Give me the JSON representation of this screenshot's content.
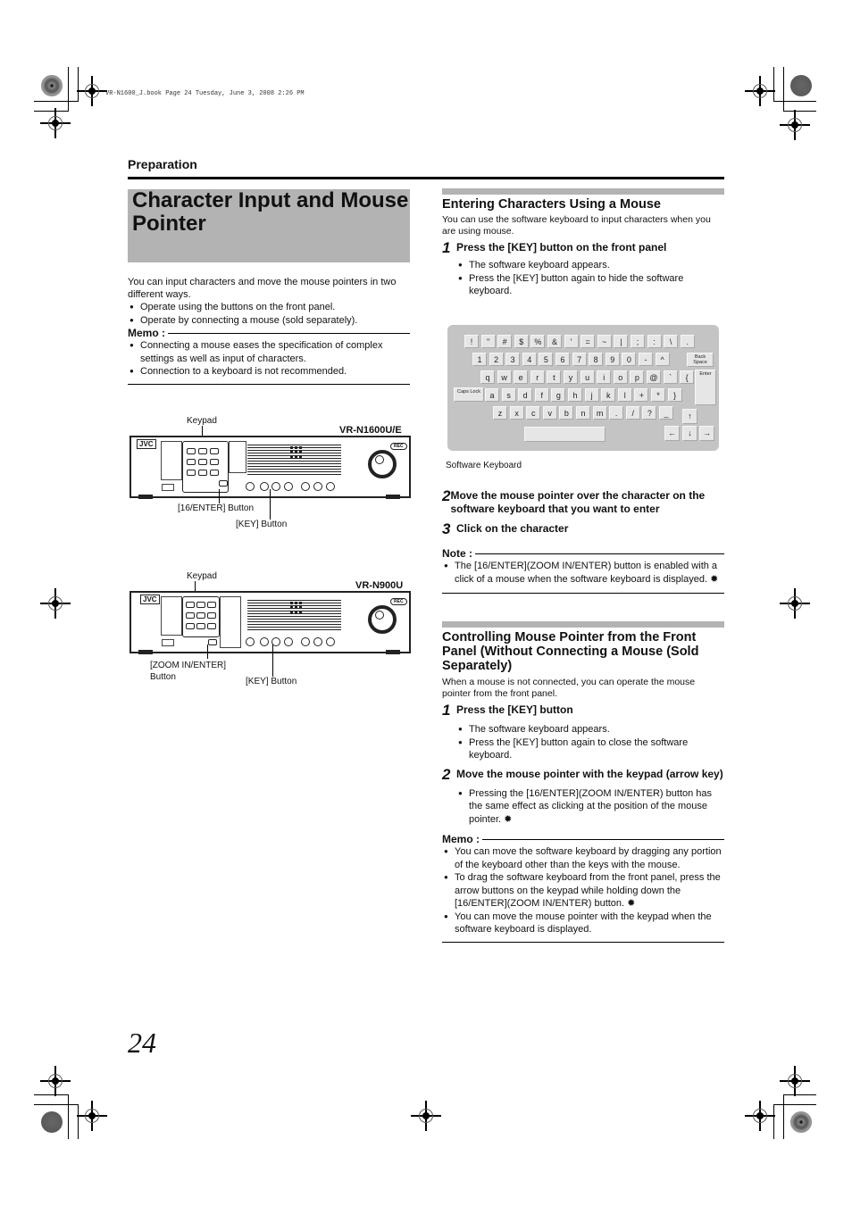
{
  "print_header": "VR-N1600_J.book  Page 24  Tuesday, June 3, 2008  2:26 PM",
  "section": "Preparation",
  "page_title": "Character Input and Mouse Pointer",
  "intro": {
    "text": "You can input characters and move the mouse pointers in two different ways.",
    "bullets": [
      "Operate using the buttons on the front panel.",
      "Operate by connecting a mouse (sold separately)."
    ]
  },
  "memo1": {
    "label": "Memo :",
    "bullets": [
      "Connecting a mouse eases the specification of complex settings as well as input of characters.",
      "Connection to a keyboard is not recommended."
    ]
  },
  "figures": {
    "device1": {
      "model": "VR-N1600U/E",
      "brand": "JVC",
      "keypad_label": "Keypad",
      "enter_label": "[16/ENTER] Button",
      "key_label": "[KEY] Button",
      "rec_label": "REC"
    },
    "device2": {
      "model": "VR-N900U",
      "brand": "JVC",
      "keypad_label": "Keypad",
      "enter_label_line1": "[ZOOM IN/ENTER]",
      "enter_label_line2": "Button",
      "key_label": "[KEY] Button",
      "rec_label": "REC"
    }
  },
  "entering": {
    "heading": "Entering Characters Using a Mouse",
    "intro": "You can use the software keyboard to input characters when you are using mouse.",
    "step1": {
      "num": "1",
      "text": "Press the [KEY] button on the front panel",
      "bullets": [
        "The software keyboard appears.",
        "Press the [KEY] button again to hide the software keyboard."
      ]
    },
    "keyboard_caption": "Software Keyboard",
    "step2": {
      "num": "2",
      "text": "Move the mouse pointer over the character on the software keyboard that you want to enter"
    },
    "step3": {
      "num": "3",
      "text": "Click on the character"
    },
    "note": {
      "label": "Note :",
      "bullets": [
        "The [16/ENTER](ZOOM IN/ENTER) button is enabled with a click of a mouse when the software keyboard is displayed."
      ]
    }
  },
  "keyboard": {
    "row1": [
      "!",
      "\"",
      "#",
      "$",
      "%",
      "&",
      "'",
      "=",
      "~",
      "|",
      ";",
      ":",
      "\\",
      "."
    ],
    "row2": [
      "1",
      "2",
      "3",
      "4",
      "5",
      "6",
      "7",
      "8",
      "9",
      "0",
      "-",
      "^"
    ],
    "row3": [
      "q",
      "w",
      "e",
      "r",
      "t",
      "y",
      "u",
      "i",
      "o",
      "p",
      "@",
      "`",
      "{"
    ],
    "row4": [
      "a",
      "s",
      "d",
      "f",
      "g",
      "h",
      "j",
      "k",
      "l",
      "+",
      "*",
      "}"
    ],
    "row5": [
      "z",
      "x",
      "c",
      "v",
      "b",
      "n",
      "m",
      ".",
      "/",
      "?",
      "_"
    ],
    "backspace": "Back Space",
    "enter": "Enter",
    "capslock": "Caps Lock",
    "arrow_up": "↑",
    "arrow_left": "←",
    "arrow_down": "↓",
    "arrow_right": "→"
  },
  "controlling": {
    "heading": "Controlling Mouse Pointer from the Front Panel (Without Connecting a Mouse (Sold Separately)",
    "intro": "When a mouse is not connected, you can operate the mouse pointer from the front panel.",
    "step1": {
      "num": "1",
      "text": "Press the [KEY] button",
      "bullets": [
        "The software keyboard appears.",
        "Press the [KEY] button again to close the software keyboard."
      ]
    },
    "step2": {
      "num": "2",
      "text": "Move the mouse pointer with the keypad (arrow key)",
      "bullets": [
        "Pressing the [16/ENTER](ZOOM IN/ENTER) button has the same effect as clicking at the position of the mouse pointer."
      ]
    },
    "memo": {
      "label": "Memo :",
      "bullets": [
        "You can move the software keyboard by dragging any portion of the keyboard other than the keys with the mouse.",
        "To drag the software keyboard from the front panel, press the arrow buttons on the keypad while holding down the [16/ENTER](ZOOM IN/ENTER) button.",
        "You can move the mouse pointer with the keypad when the software keyboard is displayed."
      ]
    }
  },
  "page_number": "24"
}
